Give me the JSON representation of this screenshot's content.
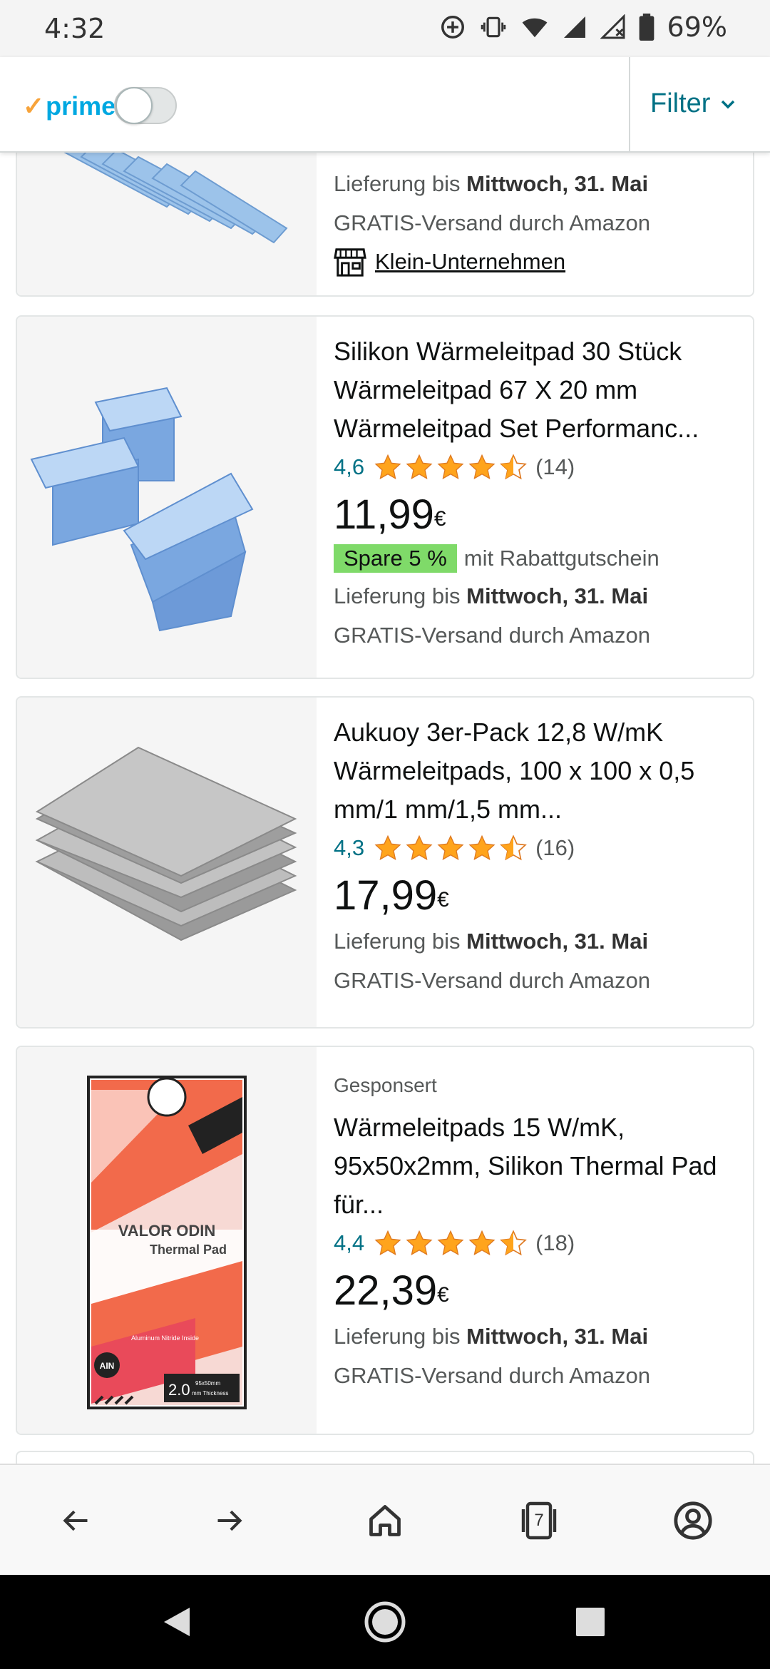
{
  "status_bar": {
    "time": "4:32",
    "battery_percent": "69%",
    "icons": [
      "data-saver-icon",
      "vibrate-icon",
      "wifi-icon",
      "signal-icon",
      "signal-no-data-icon",
      "battery-icon"
    ]
  },
  "filter_bar": {
    "prime_label": "prime",
    "prime_toggle_on": false,
    "filter_label": "Filter"
  },
  "colors": {
    "link": "#007185",
    "star": "#ffa41c",
    "coupon": "#7fda69",
    "prime": "#00a8e1"
  },
  "products": [
    {
      "delivery_prefix": "Lieferung bis",
      "delivery_date": "Mittwoch, 31. Mai",
      "shipping": "GRATIS-Versand durch Amazon",
      "small_business_label": "Klein-Unternehmen"
    },
    {
      "title": "Silikon Wärmeleitpad 30 Stück Wärmeleitpad 67 X 20 mm Wärmeleitpad Set Performanc...",
      "rating": "4,6",
      "rating_value": 4.6,
      "review_count": "(14)",
      "price_main": "11,99",
      "price_currency": "€",
      "coupon_label": "Spare 5 %",
      "coupon_text": "mit Rabattgutschein",
      "delivery_prefix": "Lieferung bis",
      "delivery_date": "Mittwoch, 31. Mai",
      "shipping": "GRATIS-Versand durch Amazon"
    },
    {
      "title": "Aukuoy 3er-Pack 12,8 W/mK Wärmeleitpads, 100 x 100 x 0,5 mm/1 mm/1,5 mm...",
      "rating": "4,3",
      "rating_value": 4.3,
      "review_count": "(16)",
      "price_main": "17,99",
      "price_currency": "€",
      "delivery_prefix": "Lieferung bis",
      "delivery_date": "Mittwoch, 31. Mai",
      "shipping": "GRATIS-Versand durch Amazon"
    },
    {
      "sponsored_label": "Gesponsert",
      "title": "Wärmeleitpads 15 W/mK, 95x50x2mm, Silikon Thermal Pad für...",
      "rating": "4,4",
      "rating_value": 4.4,
      "review_count": "(18)",
      "price_main": "22,39",
      "price_currency": "€",
      "delivery_prefix": "Lieferung bis",
      "delivery_date": "Mittwoch, 31. Mai",
      "shipping": "GRATIS-Versand durch Amazon",
      "image_text": {
        "brand": "VALOR ODIN",
        "product": "Thermal Pad",
        "note": "Aluminum Nitride Inside",
        "badge": "AIN",
        "thickness": "2.0",
        "thickness_unit": "mm Thickness",
        "size": "95x50mm"
      }
    }
  ],
  "browser_nav": {
    "tab_count": "7",
    "icons": [
      "back-arrow-icon",
      "forward-arrow-icon",
      "home-icon",
      "tabs-icon",
      "account-icon"
    ]
  },
  "android_nav": {
    "icons": [
      "back-triangle-icon",
      "home-circle-icon",
      "recents-square-icon"
    ]
  }
}
